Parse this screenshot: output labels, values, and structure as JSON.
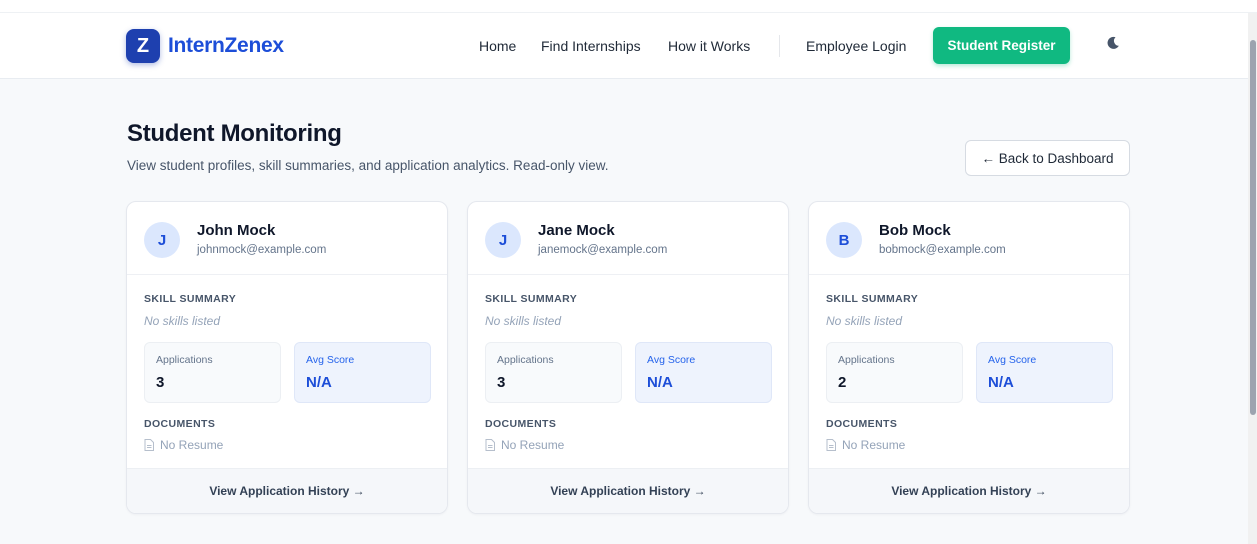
{
  "header": {
    "logo_letter": "Z",
    "brand": "InternZenex",
    "nav": {
      "home": "Home",
      "find": "Find Internships",
      "how": "How it Works",
      "employee_login": "Employee Login"
    },
    "register_label": "Student Register",
    "theme_icon": "moon-icon"
  },
  "page": {
    "title": "Student Monitoring",
    "subtitle": "View student profiles, skill summaries, and application analytics. Read-only view.",
    "back_label": "← Back to Dashboard"
  },
  "colors": {
    "brand": "#1d4ed8",
    "register": "#10b981",
    "avatar_bg": "#dbe7fd"
  },
  "students": [
    {
      "initial": "J",
      "name": "John Mock",
      "email": "johnmock@example.com",
      "skill_label": "SKILL SUMMARY",
      "skills_text": "No skills listed",
      "applications_label": "Applications",
      "applications": "3",
      "score_label": "Avg Score",
      "score": "N/A",
      "documents_label": "DOCUMENTS",
      "resume_text": "No Resume",
      "history_label": "View Application History →"
    },
    {
      "initial": "J",
      "name": "Jane Mock",
      "email": "janemock@example.com",
      "skill_label": "SKILL SUMMARY",
      "skills_text": "No skills listed",
      "applications_label": "Applications",
      "applications": "3",
      "score_label": "Avg Score",
      "score": "N/A",
      "documents_label": "DOCUMENTS",
      "resume_text": "No Resume",
      "history_label": "View Application History →"
    },
    {
      "initial": "B",
      "name": "Bob Mock",
      "email": "bobmock@example.com",
      "skill_label": "SKILL SUMMARY",
      "skills_text": "No skills listed",
      "applications_label": "Applications",
      "applications": "2",
      "score_label": "Avg Score",
      "score": "N/A",
      "documents_label": "DOCUMENTS",
      "resume_text": "No Resume",
      "history_label": "View Application History →"
    }
  ]
}
